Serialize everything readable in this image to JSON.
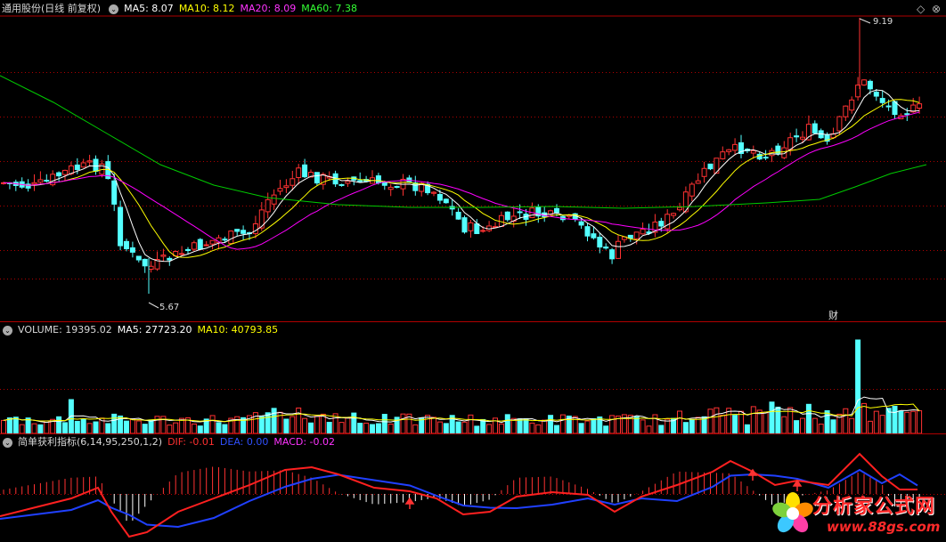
{
  "main_header": {
    "title": "通用股份(日线 前复权)",
    "ma5": "MA5: 8.07",
    "ma10": "MA10: 8.12",
    "ma20": "MA20: 8.09",
    "ma60": "MA60: 7.38"
  },
  "main_chart": {
    "high_label": "9.19",
    "low_label": "5.67",
    "event_marker": "财"
  },
  "volume_header": {
    "volume": "VOLUME: 19395.02",
    "ma5": "MA5: 27723.20",
    "ma10": "MA10: 40793.85"
  },
  "indicator_header": {
    "title": "简单获利指标(6,14,95,250,1,2)",
    "dif": "DIF: -0.01",
    "dea": "DEA: 0.00",
    "macd": "MACD: -0.02"
  },
  "watermark": {
    "name": "分析家公式网",
    "url": "www.88gs.com"
  },
  "colors": {
    "up": "#ff3232",
    "down": "#54ffff",
    "ma5": "#ffffff",
    "ma10": "#ffff00",
    "ma20": "#ff00ff",
    "ma60": "#00cc00",
    "grid": "#b00000",
    "dif": "#ff2020",
    "dea": "#2040ff"
  },
  "icons": [
    "collapse-circle-icon",
    "restore-window-icon",
    "close-window-icon"
  ]
}
